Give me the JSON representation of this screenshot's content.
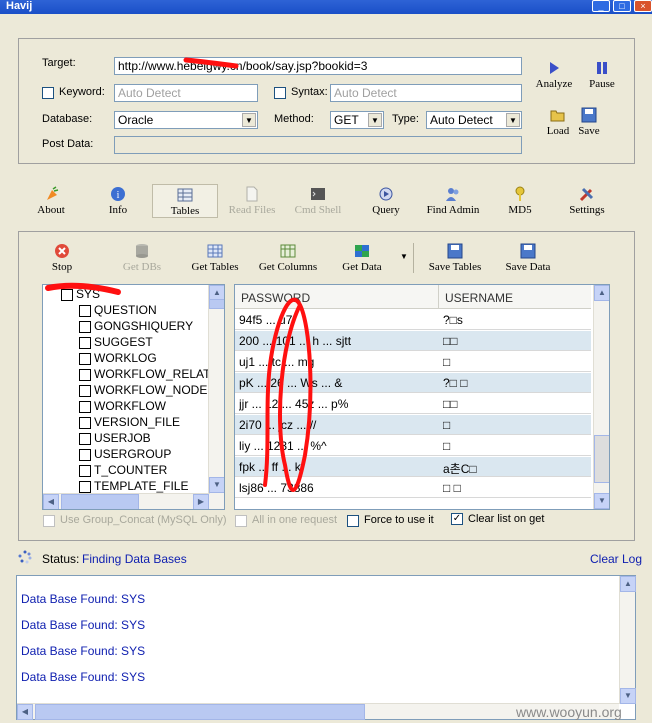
{
  "window": {
    "title": "Havij"
  },
  "form": {
    "target_label": "Target:",
    "target_value": "http://www.hebeigwy.cn/book/say.jsp?bookid=3",
    "keyword_label": "Keyword:",
    "keyword_placeholder": "Auto Detect",
    "syntax_label": "Syntax:",
    "syntax_placeholder": "Auto Detect",
    "database_label": "Database:",
    "database_value": "Oracle",
    "method_label": "Method:",
    "method_value": "GET",
    "type_label": "Type:",
    "type_value": "Auto Detect",
    "postdata_label": "Post Data:"
  },
  "actions": {
    "analyze": "Analyze",
    "pause": "Pause",
    "load": "Load",
    "save": "Save"
  },
  "tabs": [
    {
      "label": "About",
      "icon": "carrot-icon"
    },
    {
      "label": "Info",
      "icon": "info-icon"
    },
    {
      "label": "Tables",
      "icon": "table-icon"
    },
    {
      "label": "Read Files",
      "icon": "file-icon"
    },
    {
      "label": "Cmd Shell",
      "icon": "terminal-icon"
    },
    {
      "label": "Query",
      "icon": "query-icon"
    },
    {
      "label": "Find Admin",
      "icon": "users-icon"
    },
    {
      "label": "MD5",
      "icon": "key-icon"
    },
    {
      "label": "Settings",
      "icon": "tools-icon"
    }
  ],
  "toolbar": {
    "stop": "Stop",
    "get_dbs": "Get DBs",
    "get_tables": "Get Tables",
    "get_columns": "Get Columns",
    "get_data": "Get Data",
    "save_tables": "Save Tables",
    "save_data": "Save Data"
  },
  "tree": {
    "root": "SYS",
    "items": [
      "QUESTION",
      "GONGSHIQUERY",
      "SUGGEST",
      "WORKLOG",
      "WORKFLOW_RELATIO",
      "WORKFLOW_NODE",
      "WORKFLOW",
      "VERSION_FILE",
      "USERJOB",
      "USERGROUP",
      "T_COUNTER",
      "TEMPLATE_FILE"
    ]
  },
  "grid": {
    "columns": [
      "PASSWORD",
      "USERNAME"
    ],
    "rows": [
      [
        "94f5 ... u7",
        "?□s"
      ],
      [
        "200 ... 101 ... h ... sjtt",
        "□□"
      ],
      [
        "uj1 ... tc ... mg",
        "□"
      ],
      [
        "pK ... 26 ... Ws ... &",
        "?□ □"
      ],
      [
        "jjr ... 12 ... 45z ... p%",
        "□□"
      ],
      [
        "2i70 ... jcz ... //",
        "□"
      ],
      [
        "liy ... 1231 ... %^",
        "□"
      ],
      [
        "fpk ... ff ... kf",
        "a촌C□"
      ],
      [
        "lsj86 ... 73886",
        "□ □"
      ]
    ]
  },
  "options": {
    "group_concat": "Use Group_Concat (MySQL Only)",
    "all_in_one": "All in one request",
    "force_use": "Force to use it",
    "clear_list": "Clear list on get"
  },
  "status": {
    "label": "Status:",
    "value": "Finding Data Bases",
    "clear_log": "Clear Log"
  },
  "log": [
    "Data Base Found: SYS",
    "Data Base Found: SYS",
    "Data Base Found: SYS",
    "Data Base Found: SYS"
  ],
  "watermark": "www.wooyun.org",
  "colors": {
    "window_bg": "#ece9d8",
    "titlebar": "#1a4fc7",
    "link_blue": "#1020b0",
    "grid_alt_row": "#dae7f0",
    "scribble_red": "#ff1010"
  }
}
